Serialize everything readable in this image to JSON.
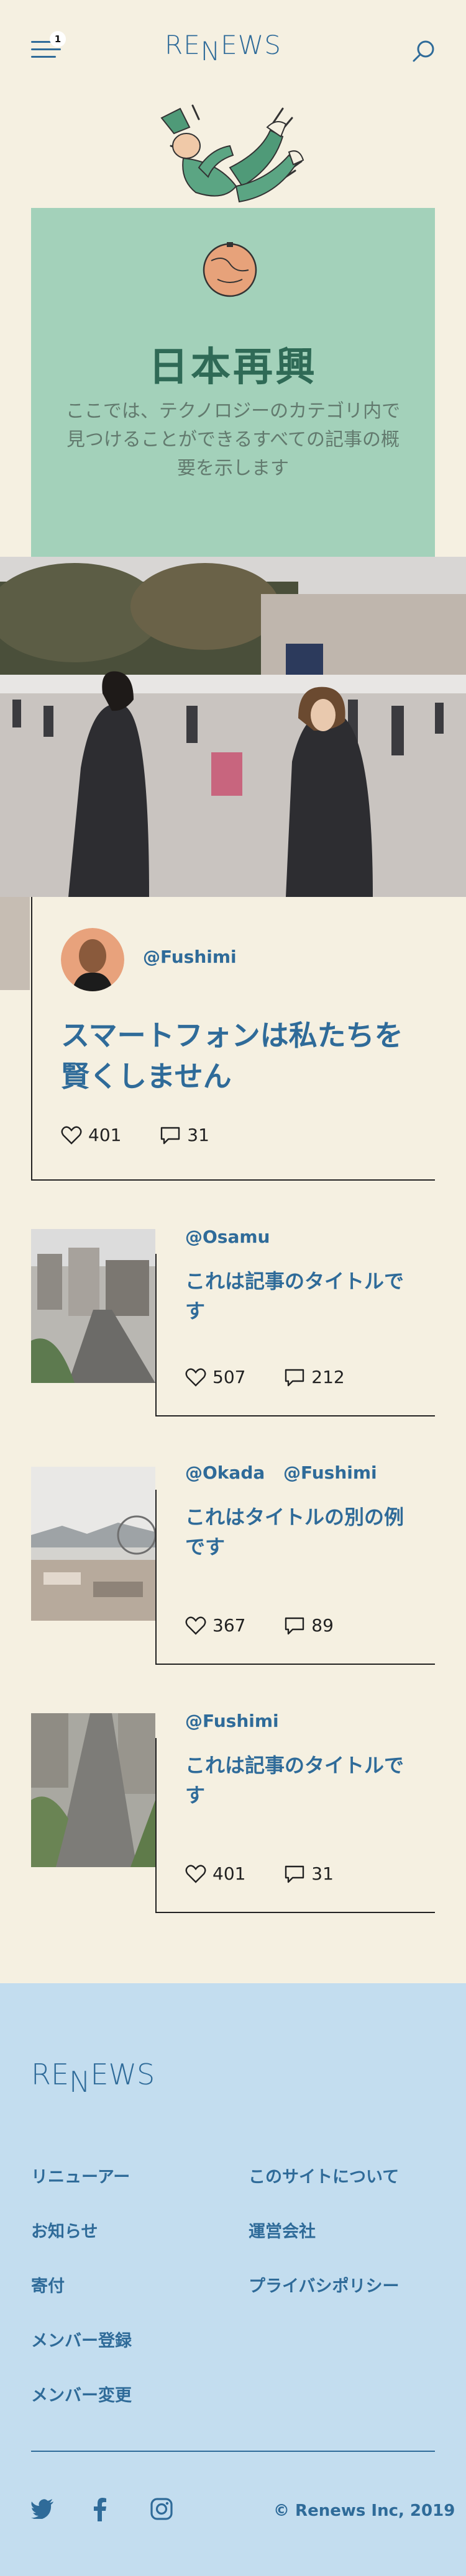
{
  "header": {
    "logo": {
      "r": "R",
      "e1": "E",
      "n": "N",
      "e2": "E",
      "ws": "WS"
    },
    "menu_badge": "1",
    "icons": [
      "menu-icon",
      "search-icon"
    ]
  },
  "hero": {
    "title": "日本再興",
    "description": "ここでは、テクノロジーのカテゴリ内で見つけることができるすべての記事の概要を示します"
  },
  "featured": {
    "author": "@Fushimi",
    "title": "スマートフォンは私たちを賢くしません",
    "likes": "401",
    "comments": "31"
  },
  "articles": [
    {
      "authors": [
        "@Osamu"
      ],
      "title": "これは記事のタイトルです",
      "likes": "507",
      "comments": "212"
    },
    {
      "authors": [
        "@Okada",
        "@Fushimi"
      ],
      "title": "これはタイトルの別の例です",
      "likes": "367",
      "comments": "89"
    },
    {
      "authors": [
        "@Fushimi"
      ],
      "title": "これは記事のタイトルです",
      "likes": "401",
      "comments": "31"
    }
  ],
  "footer": {
    "logo": {
      "r": "R",
      "e1": "E",
      "n": "N",
      "e2": "E",
      "ws": "WS"
    },
    "links_left": [
      "リニューアー",
      "お知らせ",
      "寄付",
      "メンバー登録",
      "メンバー変更"
    ],
    "links_right": [
      "このサイトについて",
      "運営会社",
      "プライバシポリシー"
    ],
    "social_icons": [
      "twitter-icon",
      "facebook-icon",
      "instagram-icon"
    ],
    "copyright": "© Renews Inc, 2019"
  },
  "colors": {
    "background": "#f5f0e1",
    "accent": "#2f6b99",
    "hero": "#a3d1ba",
    "footer": "#c3ddef"
  }
}
